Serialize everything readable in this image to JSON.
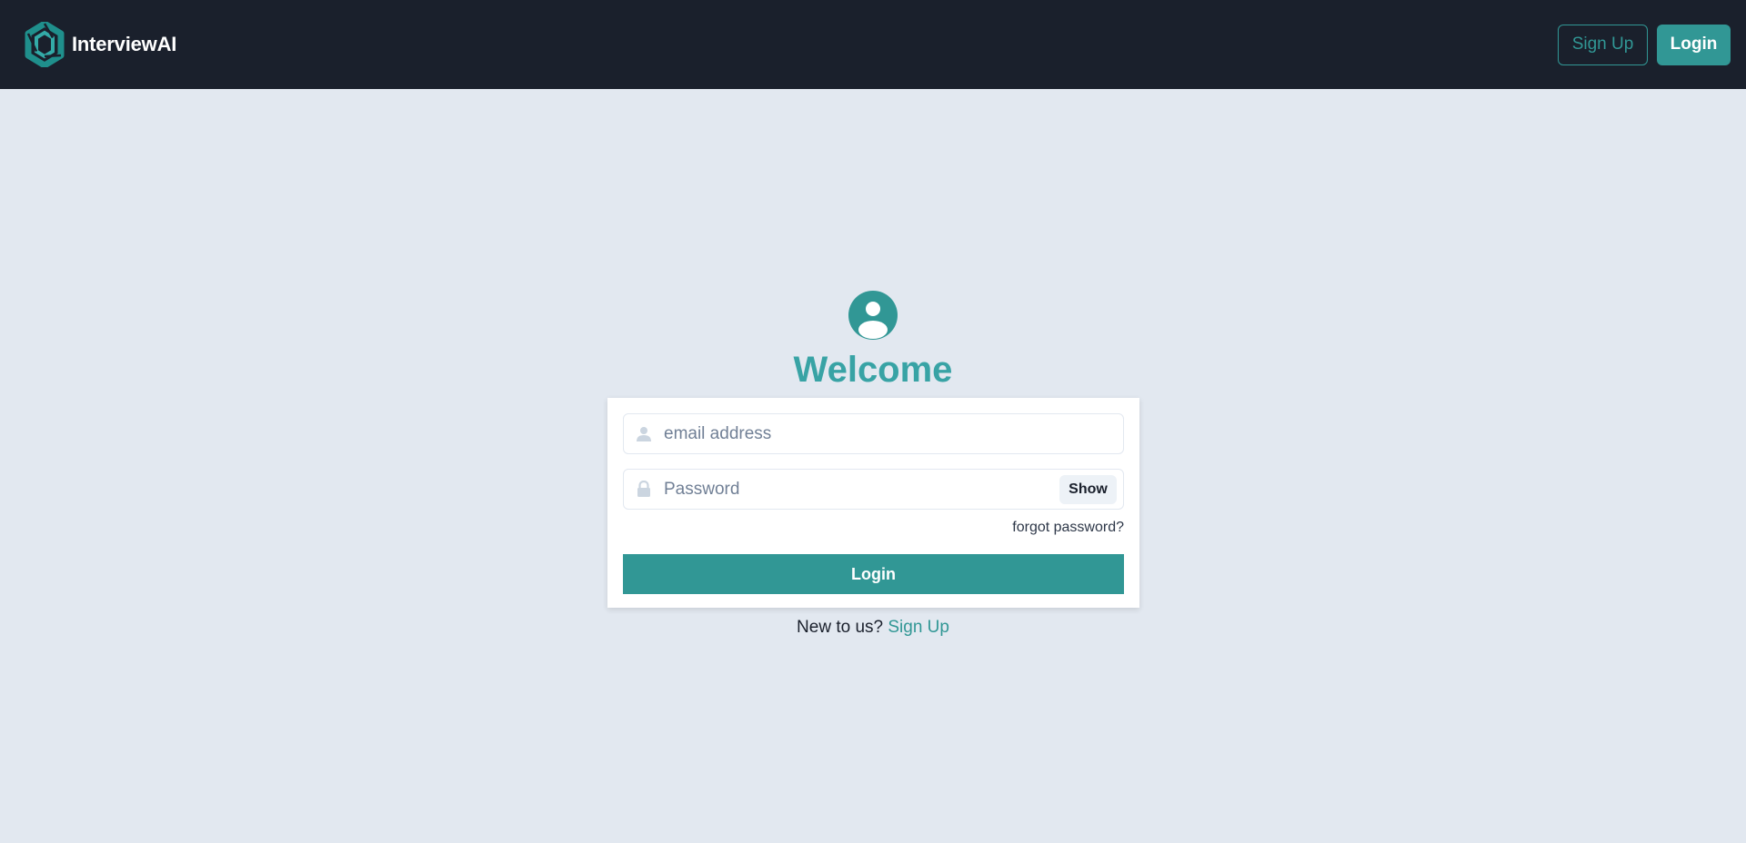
{
  "header": {
    "brand_name": "InterviewAI",
    "logo_icon": "hexagon-logo-icon",
    "signup_label": "Sign Up",
    "login_label": "Login"
  },
  "main": {
    "avatar_icon": "user-circle-icon",
    "welcome_title": "Welcome",
    "email": {
      "placeholder": "email address",
      "value": "",
      "icon": "user-icon"
    },
    "password": {
      "placeholder": "Password",
      "value": "",
      "icon": "lock-icon",
      "show_label": "Show"
    },
    "forgot_label": "forgot password?",
    "submit_label": "Login",
    "signup_prompt": "New to us?",
    "signup_link": "Sign Up"
  },
  "colors": {
    "accent": "#319795",
    "navbar_bg": "#1a202c",
    "page_bg": "#e2e8f0",
    "welcome_text": "#38a3a5"
  }
}
